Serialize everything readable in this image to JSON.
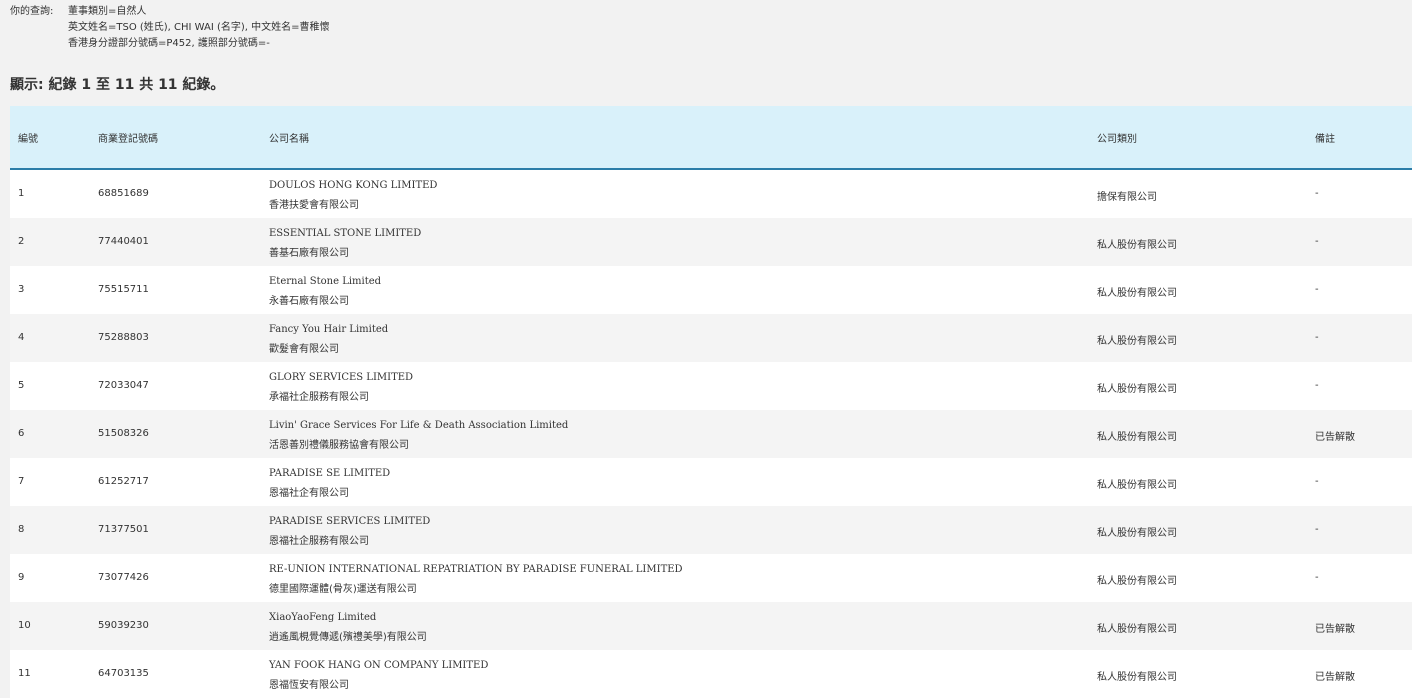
{
  "query": {
    "label": "你的查詢:",
    "lines": [
      "董事類別=自然人",
      "英文姓名=TSO (姓氏), CHI WAI (名字), 中文姓名=曹稚懷",
      "香港身分證部分號碼=P452, 護照部分號碼=-"
    ]
  },
  "summary": "顯示: 紀錄 1 至 11 共 11 紀錄。",
  "table": {
    "headers": {
      "no": "編號",
      "brn": "商業登記號碼",
      "name": "公司名稱",
      "type": "公司類別",
      "remark": "備註"
    },
    "rows": [
      {
        "no": "1",
        "brn": "68851689",
        "name_en": "DOULOS HONG KONG LIMITED",
        "name_zh": "香港扶愛會有限公司",
        "type": "擔保有限公司",
        "remark": "-"
      },
      {
        "no": "2",
        "brn": "77440401",
        "name_en": "ESSENTIAL STONE LIMITED",
        "name_zh": "善基石廠有限公司",
        "type": "私人股份有限公司",
        "remark": "-"
      },
      {
        "no": "3",
        "brn": "75515711",
        "name_en": "Eternal Stone Limited",
        "name_zh": "永善石廠有限公司",
        "type": "私人股份有限公司",
        "remark": "-"
      },
      {
        "no": "4",
        "brn": "75288803",
        "name_en": "Fancy You Hair Limited",
        "name_zh": "歡髮會有限公司",
        "type": "私人股份有限公司",
        "remark": "-"
      },
      {
        "no": "5",
        "brn": "72033047",
        "name_en": "GLORY SERVICES LIMITED",
        "name_zh": "承福社企服務有限公司",
        "type": "私人股份有限公司",
        "remark": "-"
      },
      {
        "no": "6",
        "brn": "51508326",
        "name_en": "Livin' Grace Services For Life & Death Association Limited",
        "name_zh": "活恩善別禮儀服務協會有限公司",
        "type": "私人股份有限公司",
        "remark": "已告解散"
      },
      {
        "no": "7",
        "brn": "61252717",
        "name_en": "PARADISE SE LIMITED",
        "name_zh": "恩福社企有限公司",
        "type": "私人股份有限公司",
        "remark": "-"
      },
      {
        "no": "8",
        "brn": "71377501",
        "name_en": "PARADISE SERVICES LIMITED",
        "name_zh": "恩福社企服務有限公司",
        "type": "私人股份有限公司",
        "remark": "-"
      },
      {
        "no": "9",
        "brn": "73077426",
        "name_en": "RE-UNION INTERNATIONAL REPATRIATION BY PARADISE FUNERAL LIMITED",
        "name_zh": "德里國際運體(骨灰)運送有限公司",
        "type": "私人股份有限公司",
        "remark": "-"
      },
      {
        "no": "10",
        "brn": "59039230",
        "name_en": "XiaoYaoFeng Limited",
        "name_zh": "逍遙風梘覺傳遞(殯禮美學)有限公司",
        "type": "私人股份有限公司",
        "remark": "已告解散"
      },
      {
        "no": "11",
        "brn": "64703135",
        "name_en": "YAN FOOK HANG ON COMPANY LIMITED",
        "name_zh": "恩福恆安有限公司",
        "type": "私人股份有限公司",
        "remark": "已告解散"
      }
    ]
  }
}
